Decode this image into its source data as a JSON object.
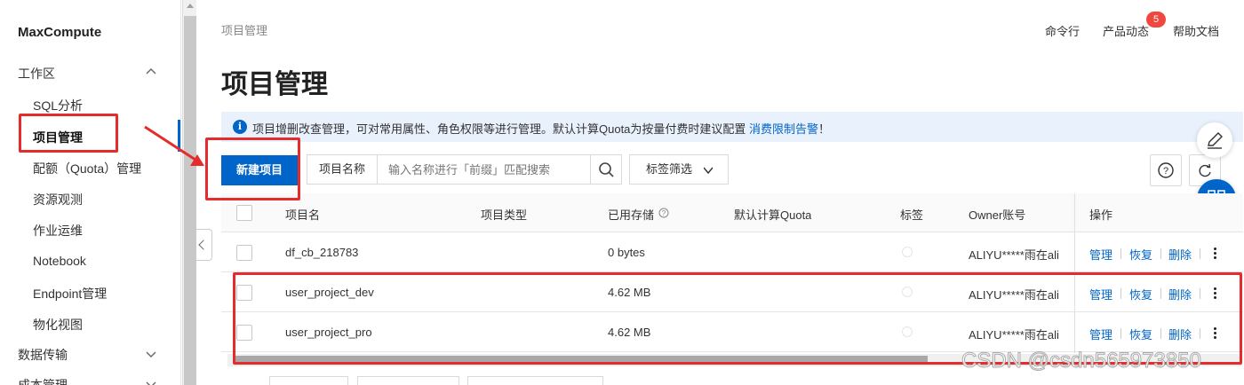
{
  "sidebar": {
    "brand": "MaxCompute",
    "groups": [
      {
        "label": "工作区"
      },
      {
        "label": "数据传输"
      },
      {
        "label": "成本管理"
      }
    ],
    "items": [
      {
        "label": "SQL分析"
      },
      {
        "label": "项目管理"
      },
      {
        "label": "配额（Quota）管理"
      },
      {
        "label": "资源观测"
      },
      {
        "label": "作业运维"
      },
      {
        "label": "Notebook"
      },
      {
        "label": "Endpoint管理"
      },
      {
        "label": "物化视图"
      }
    ]
  },
  "header": {
    "breadcrumb": "项目管理",
    "links": {
      "cli": "命令行",
      "updates": "产品动态",
      "help": "帮助文档"
    },
    "updates_badge": "5",
    "title": "项目管理"
  },
  "notice": {
    "text": "项目增删改查管理，可对常用属性、角色权限等进行管理。默认计算Quota为按量付费时建议配置 ",
    "link": "消费限制告警",
    "suffix": "！"
  },
  "toolbar": {
    "create_label": "新建项目",
    "field_label": "项目名称",
    "search_placeholder": "输入名称进行「前缀」匹配搜索",
    "tag_filter": "标签筛选"
  },
  "table": {
    "headers": [
      "项目名",
      "项目类型",
      "已用存储",
      "默认计算Quota",
      "标签",
      "Owner账号",
      "操作"
    ],
    "rows": [
      {
        "name": "df_cb_218783",
        "type": "",
        "storage": "0 bytes",
        "quota": "",
        "owner": "ALIYU*****雨在ali"
      },
      {
        "name": "user_project_dev",
        "type": "",
        "storage": "4.62 MB",
        "quota": "",
        "owner": "ALIYU*****雨在ali"
      },
      {
        "name": "user_project_pro",
        "type": "",
        "storage": "4.62 MB",
        "quota": "",
        "owner": "ALIYU*****雨在ali"
      }
    ],
    "actions": {
      "manage": "管理",
      "restore": "恢复",
      "delete": "删除"
    }
  },
  "watermark": "CSDN @csdn565973850",
  "colors": {
    "accent": "#0064c8",
    "annotation": "#e52b2b",
    "badge": "#f0483e",
    "notice_bg": "#e9f2fc"
  },
  "icons": [
    "chevron-up-icon",
    "chevron-down-icon",
    "info-icon",
    "search-icon",
    "help-icon",
    "refresh-icon",
    "edit-icon",
    "apps-grid-icon",
    "more-vertical-icon",
    "chevron-left-icon"
  ]
}
